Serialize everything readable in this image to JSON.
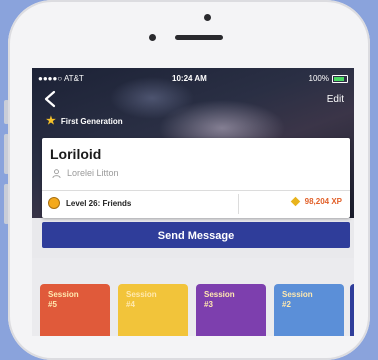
{
  "status_bar": {
    "carrier": "●●●●○ AT&T",
    "time": "10:24 AM",
    "battery": "100%"
  },
  "header": {
    "edit_label": "Edit",
    "badge_label": "First Generation"
  },
  "profile": {
    "name": "Loriloid",
    "username": "Lorelei Litton",
    "level_text": "Level  26: Friends",
    "xp_text": "98,204 XP"
  },
  "actions": {
    "send_message_label": "Send Message"
  },
  "sessions": [
    {
      "title": "Session",
      "number": "#5",
      "color": "#e05a3a"
    },
    {
      "title": "Session",
      "number": "#4",
      "color": "#f2c43a"
    },
    {
      "title": "Session",
      "number": "#3",
      "color": "#7d3fae"
    },
    {
      "title": "Session",
      "number": "#2",
      "color": "#5b8fd8"
    }
  ],
  "colors": {
    "accent": "#2f3d9a",
    "xp": "#e2612a",
    "background": "#8aa3dc"
  },
  "icons": {
    "back": "chevron-left-icon",
    "star": "star-icon",
    "user": "user-icon",
    "medal": "medal-icon",
    "gem": "gem-icon"
  }
}
